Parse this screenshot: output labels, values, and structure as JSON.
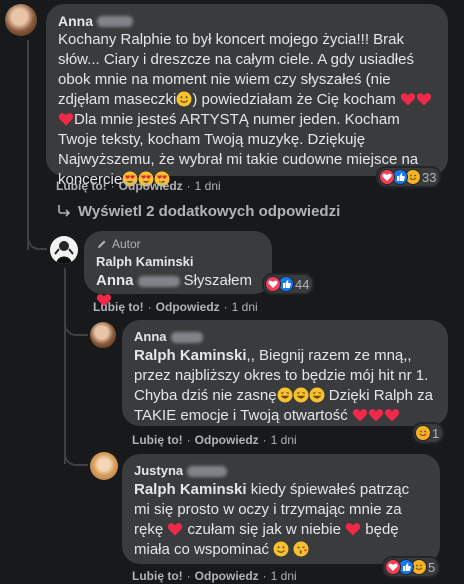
{
  "comments": [
    {
      "author": "Anna",
      "text_parts": [
        "Kochany Ralphie to był koncert mojego życia!!! Brak słów... Ciary i dreszcze na całym ciele. A gdy usiadłeś obok mnie na moment nie wiem czy słyszałeś (nie zdjęłam maseczki",
        ") powiedziałam że Cię kocham ",
        "Dla mnie jesteś ARTYSTĄ numer jeden. Kocham Twoje teksty, kocham Twoją muzykę. Dziękuję Najwyższemu, że wybrał mi takie cudowne miejsce na koncercie"
      ],
      "like": "Lubię to!",
      "reply": "Odpowiedz",
      "time": "1 dni",
      "reaction_count": "33"
    },
    {
      "view_more": "Wyświetl 2 dodatkowych odpowiedzi"
    },
    {
      "badge": "Autor",
      "author": "Ralph Kaminski",
      "mention": "Anna",
      "text": "Słyszałem",
      "like": "Lubię to!",
      "reply": "Odpowiedz",
      "time": "1 dni",
      "reaction_count": "44"
    },
    {
      "author": "Anna",
      "mention": "Ralph Kaminski",
      "text_parts": [
        ",, Biegnij razem ze mną,, przez najbliższy okres to będzie mój hit nr 1. Chyba dziś nie zasnę",
        " Dzięki Ralph za TAKIE emocje i Twoją otwartość "
      ],
      "like": "Lubię to!",
      "reply": "Odpowiedz",
      "time": "1 dni",
      "reaction_count": "1"
    },
    {
      "author": "Justyna",
      "mention": "Ralph Kaminski",
      "text_parts": [
        " kiedy śpiewałeś patrząc mi się prosto w oczy i trzymając mnie za rękę ",
        " czułam się jak w niebie ",
        " będę miała co wspominać "
      ],
      "like": "Lubię to!",
      "reply": "Odpowiedz",
      "time": "1 dni",
      "reaction_count": "5"
    }
  ],
  "colors": {
    "background": "#18191a",
    "bubble": "#3a3b3c",
    "text": "#e4e6eb",
    "muted": "#b0b3b8",
    "like_blue": "#1877f2",
    "love_red": "#f33e58",
    "haha_yellow": "#f7b125"
  }
}
